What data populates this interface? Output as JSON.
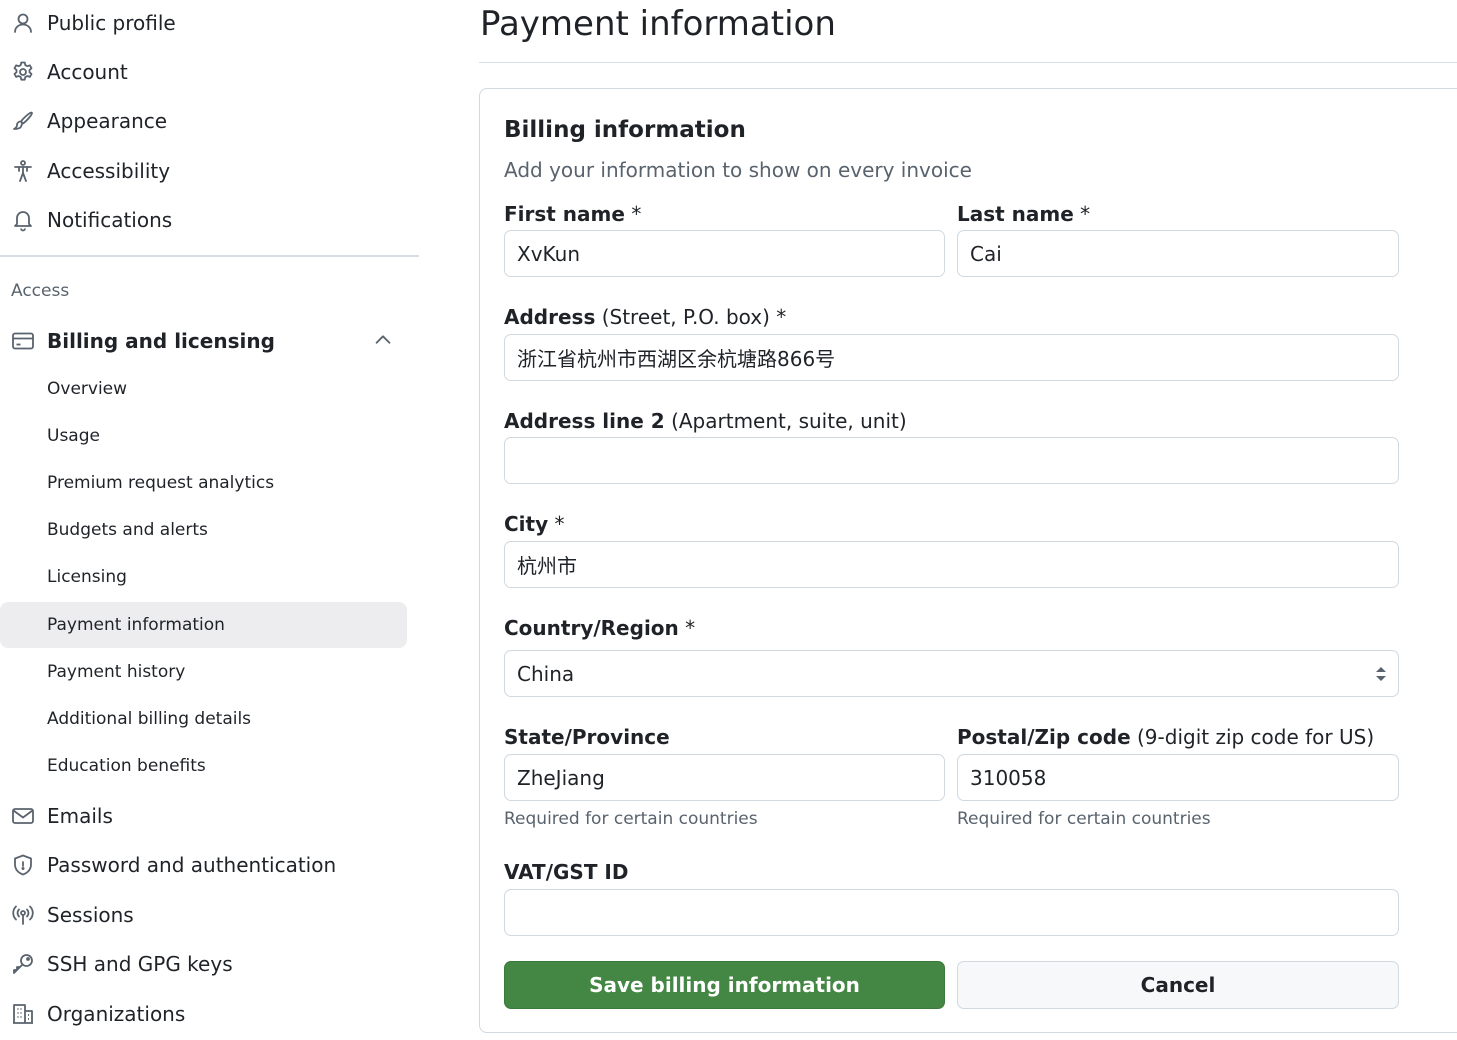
{
  "sidebar": {
    "top_items": [
      {
        "label": "Public profile",
        "icon": "person-icon"
      },
      {
        "label": "Account",
        "icon": "gear-icon"
      },
      {
        "label": "Appearance",
        "icon": "paintbrush-icon"
      },
      {
        "label": "Accessibility",
        "icon": "accessibility-icon"
      },
      {
        "label": "Notifications",
        "icon": "bell-icon"
      }
    ],
    "access_heading": "Access",
    "billing": {
      "label": "Billing and licensing",
      "icon": "credit-card-icon",
      "expanded": true,
      "sub_items": [
        {
          "label": "Overview"
        },
        {
          "label": "Usage"
        },
        {
          "label": "Premium request analytics"
        },
        {
          "label": "Budgets and alerts"
        },
        {
          "label": "Licensing"
        },
        {
          "label": "Payment information",
          "active": true
        },
        {
          "label": "Payment history"
        },
        {
          "label": "Additional billing details"
        },
        {
          "label": "Education benefits"
        }
      ]
    },
    "bottom_items": [
      {
        "label": "Emails",
        "icon": "mail-icon"
      },
      {
        "label": "Password and authentication",
        "icon": "shield-icon"
      },
      {
        "label": "Sessions",
        "icon": "broadcast-icon"
      },
      {
        "label": "SSH and GPG keys",
        "icon": "key-icon"
      },
      {
        "label": "Organizations",
        "icon": "organization-icon"
      }
    ]
  },
  "main": {
    "title": "Payment information",
    "billing": {
      "heading": "Billing information",
      "subheading": "Add your information to show on every invoice",
      "first_name": {
        "label": "First name",
        "required_mark": "*",
        "value": "XvKun"
      },
      "last_name": {
        "label": "Last name",
        "required_mark": "*",
        "value": "Cai"
      },
      "address": {
        "label": "Address",
        "hint": "(Street, P.O. box)",
        "required_mark": "*",
        "value": "浙江省杭州市西湖区余杭塘路866号"
      },
      "address2": {
        "label": "Address line 2",
        "hint": "(Apartment, suite, unit)",
        "value": ""
      },
      "city": {
        "label": "City",
        "required_mark": "*",
        "value": "杭州市"
      },
      "country": {
        "label": "Country/Region",
        "required_mark": "*",
        "value": "China"
      },
      "state": {
        "label": "State/Province",
        "value": "ZheJiang",
        "help": "Required for certain countries"
      },
      "postal": {
        "label": "Postal/Zip code",
        "hint": "(9-digit zip code for US)",
        "value": "310058",
        "help": "Required for certain countries"
      },
      "vat": {
        "label": "VAT/GST ID",
        "value": ""
      },
      "save_label": "Save billing information",
      "cancel_label": "Cancel"
    }
  },
  "colors": {
    "primary_button": "#448643",
    "active_nav_bg": "#ededef",
    "muted_text": "#59636e",
    "border": "#d1d9e0"
  }
}
